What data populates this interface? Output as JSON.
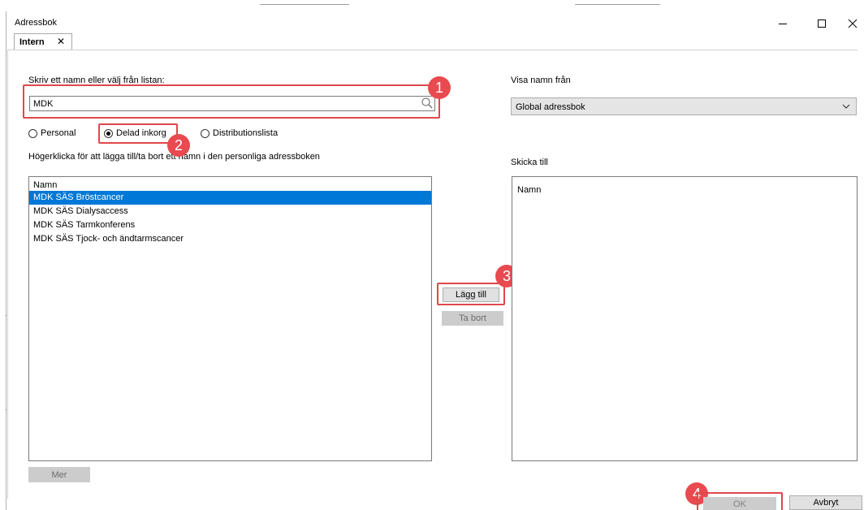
{
  "window": {
    "title": "Adressbok",
    "minimize_icon": "minimize-icon",
    "maximize_icon": "maximize-icon",
    "close_icon": "close-icon"
  },
  "tab": {
    "label": "Intern",
    "close_glyph": "✕"
  },
  "search": {
    "label": "Skriv ett namn eller välj från listan:",
    "value": "MDK",
    "icon": "search-icon"
  },
  "radios": [
    {
      "label": "Personal",
      "selected": false
    },
    {
      "label": "Delad inkorg",
      "selected": true
    },
    {
      "label": "Distributionslista",
      "selected": false
    }
  ],
  "hint": "Högerklicka för att lägga till/ta bort ett namn i den personliga adressboken",
  "results": {
    "header": "Namn",
    "rows": [
      "MDK SÄS Bröstcancer",
      "MDK SÄS Dialysaccess",
      "MDK SÄS Tarmkonferens",
      "MDK SÄS Tjock- och ändtarmscancer"
    ],
    "selected_index": 0
  },
  "more_button": "Mer",
  "add_button": "Lägg till",
  "remove_button": "Ta bort",
  "source": {
    "label": "Visa namn från",
    "selected": "Global adressbok"
  },
  "send_to": {
    "label": "Skicka till",
    "header": "Namn"
  },
  "ok_button": "OK",
  "cancel_button": "Avbryt",
  "badges": [
    "1",
    "2",
    "3",
    "4"
  ],
  "colors": {
    "highlight": "#e0474c",
    "badge": "#e84a4f",
    "selection": "#0078d7"
  }
}
